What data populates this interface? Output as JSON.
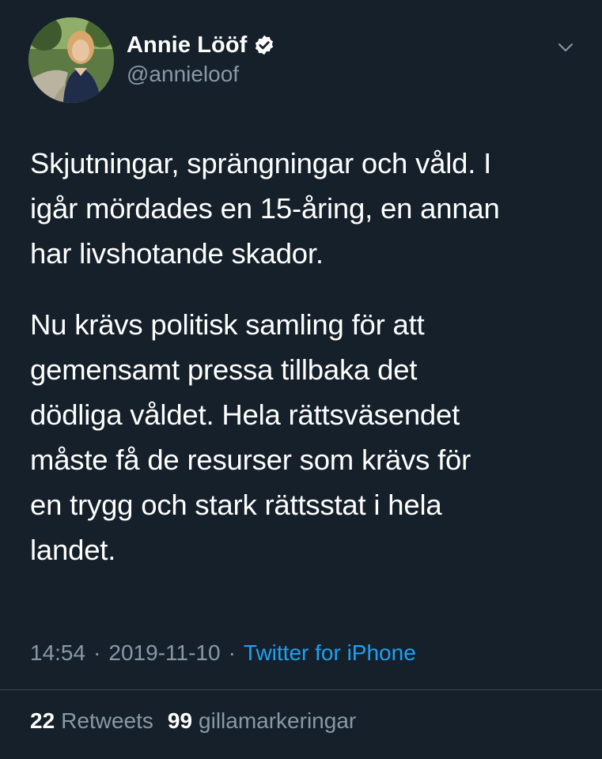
{
  "tweet": {
    "author": {
      "display_name": "Annie Lööf",
      "handle": "@annieloof",
      "verified": true
    },
    "paragraphs": [
      "Skjutningar, sprängningar och våld. I\nigår mördades en 15-åring, en annan\nhar livshotande skador.",
      "Nu krävs politisk samling för att\ngemensamt pressa tillbaka det\ndödliga våldet. Hela rättsväsendet\nmåste få de resurser som krävs för\nen trygg och stark rättsstat i hela\nlandet."
    ],
    "meta": {
      "time": "14:54",
      "separator": "·",
      "date": "2019-11-10",
      "source": "Twitter for iPhone"
    },
    "stats": {
      "retweets_count": "22",
      "retweets_label": "Retweets",
      "likes_count": "99",
      "likes_label": "gillamarkeringar"
    }
  },
  "colors": {
    "background": "#15202b",
    "text_primary": "#ffffff",
    "text_secondary": "#8899a6",
    "accent": "#1da1f2",
    "divider": "#38444d"
  },
  "icons": {
    "verified": "verified-badge-icon",
    "menu": "chevron-down-icon"
  }
}
